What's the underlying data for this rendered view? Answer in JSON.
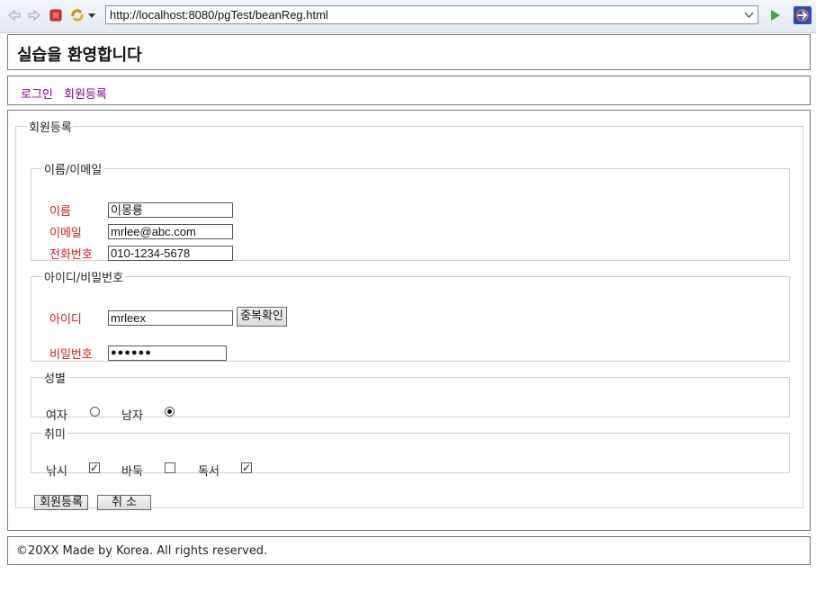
{
  "browser": {
    "url": "http://localhost:8080/pgTest/beanReg.html"
  },
  "header": {
    "title": "실습을 환영합니다"
  },
  "nav": {
    "items": [
      {
        "label": "로그인"
      },
      {
        "label": "회원등록"
      }
    ]
  },
  "form": {
    "legend": "회원등록",
    "name_email": {
      "legend": "이름/이메일",
      "name_label": "이름",
      "name_value": "이몽룡",
      "email_label": "이메일",
      "email_value": "mrlee@abc.com",
      "phone_label": "전화번호",
      "phone_value": "010-1234-5678"
    },
    "account": {
      "legend": "아이디/비밀번호",
      "id_label": "아이디",
      "id_value": "mrleex",
      "dup_check_label": "중복확인",
      "password_label": "비밀번호",
      "password_mask": "●●●●●●"
    },
    "gender": {
      "legend": "성별",
      "female_label": "여자",
      "male_label": "남자",
      "selected": "남자"
    },
    "hobby": {
      "legend": "취미",
      "fishing_label": "낚시",
      "fishing_checked": true,
      "baduk_label": "바둑",
      "baduk_checked": false,
      "reading_label": "독서",
      "reading_checked": true
    },
    "submit_label": "회원등록",
    "cancel_label": "취 소"
  },
  "footer": {
    "text": "©20XX Made by Korea. All rights reserved."
  }
}
